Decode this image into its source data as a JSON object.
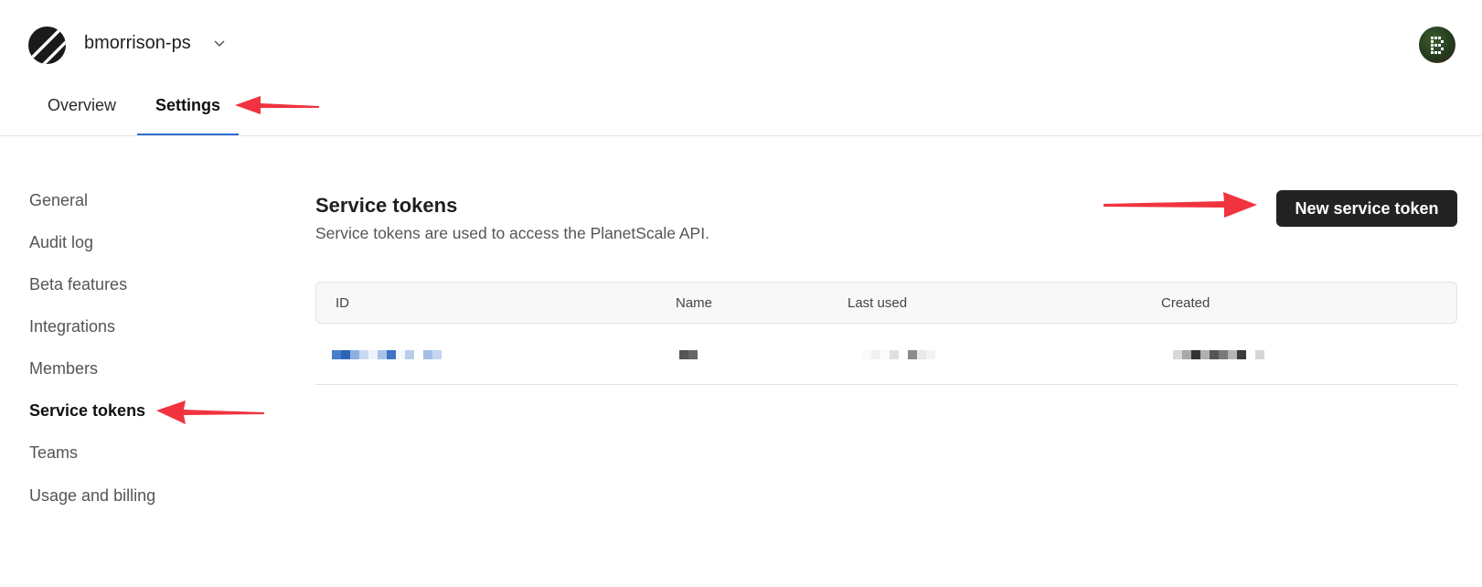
{
  "header": {
    "org_name": "bmorrison-ps",
    "logo_icon": "planetscale-logo-icon",
    "chevron_icon": "chevron-down-icon",
    "avatar_icon": "user-avatar-icon"
  },
  "tabs": [
    {
      "label": "Overview",
      "active": false
    },
    {
      "label": "Settings",
      "active": true
    }
  ],
  "sidebar": {
    "items": [
      {
        "label": "General",
        "active": false
      },
      {
        "label": "Audit log",
        "active": false
      },
      {
        "label": "Beta features",
        "active": false
      },
      {
        "label": "Integrations",
        "active": false
      },
      {
        "label": "Members",
        "active": false
      },
      {
        "label": "Service tokens",
        "active": true
      },
      {
        "label": "Teams",
        "active": false
      },
      {
        "label": "Usage and billing",
        "active": false
      }
    ]
  },
  "main": {
    "title": "Service tokens",
    "subtitle": "Service tokens are used to access the PlanetScale API.",
    "new_button_label": "New service token",
    "table": {
      "columns": [
        "ID",
        "Name",
        "Last used",
        "Created"
      ],
      "rows": [
        {
          "id": "[redacted]",
          "name": "[redacted]",
          "last_used": "[redacted]",
          "created": "[redacted]"
        }
      ]
    }
  },
  "colors": {
    "accent": "#2f6fd0",
    "button_bg": "#232323",
    "annotation_arrow": "#f0333f"
  }
}
